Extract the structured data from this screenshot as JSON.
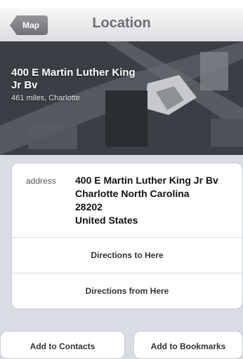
{
  "nav": {
    "back_label": "Map",
    "title": "Location"
  },
  "header": {
    "title": "400 E Martin Luther King Jr Bv",
    "subtitle": "461 miles, Charlotte"
  },
  "address": {
    "label": "address",
    "lines": [
      "400 E Martin Luther King Jr Bv",
      "Charlotte North Carolina",
      "28202",
      "United States"
    ]
  },
  "actions": {
    "directions_to": "Directions to Here",
    "directions_from": "Directions from Here"
  },
  "buttons": {
    "add_contacts": "Add to Contacts",
    "add_bookmarks": "Add to Bookmarks"
  }
}
